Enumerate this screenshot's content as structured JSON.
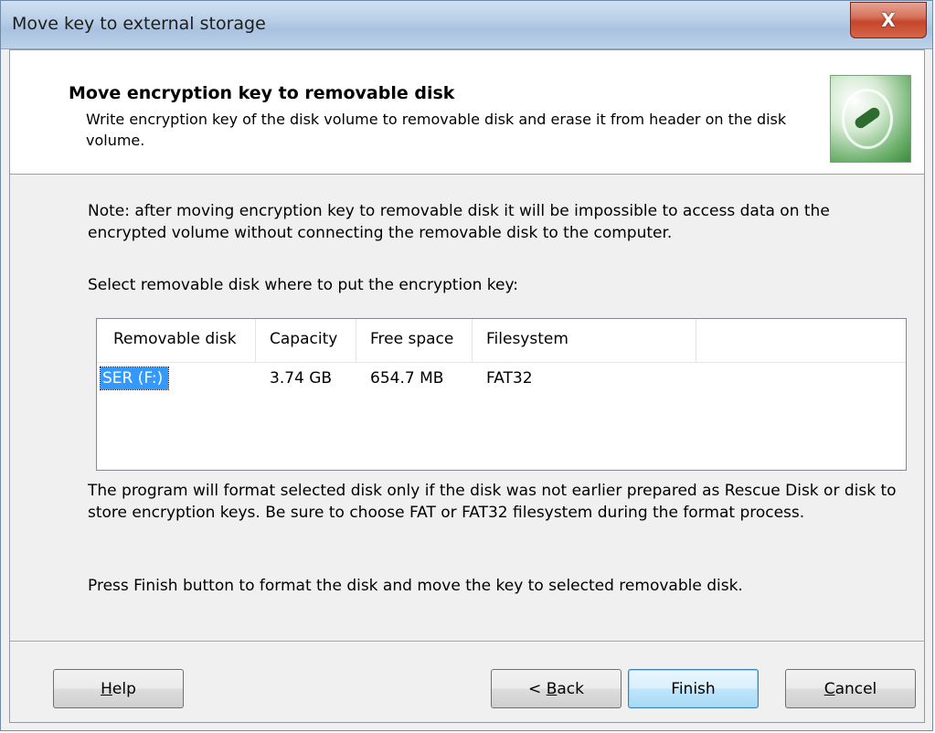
{
  "window": {
    "title": "Move key to external storage",
    "close_label": "X"
  },
  "header": {
    "title": "Move encryption key to removable disk",
    "subtitle": "Write encryption key of the disk volume to removable disk and erase it from header on the disk volume.",
    "logo_icon": "key-lock-icon"
  },
  "body": {
    "note": "Note: after moving encryption key to removable disk it will be impossible to access data on the encrypted volume without connecting the removable disk to the computer.",
    "select_prompt": "Select removable disk where to put the encryption key:",
    "format_info": "The program will format selected disk only if the disk was not earlier prepared as Rescue Disk or disk to store encryption keys. Be sure to choose FAT or FAT32 filesystem during the format process.",
    "finish_hint": "Press Finish button to format the disk and move the key to selected removable disk."
  },
  "disk_list": {
    "columns": [
      "Removable disk",
      "Capacity",
      "Free space",
      "Filesystem",
      ""
    ],
    "rows": [
      {
        "disk": "SER (F:)",
        "capacity": "3.74 GB",
        "free_space": "654.7 MB",
        "filesystem": "FAT32",
        "selected": true
      }
    ]
  },
  "buttons": {
    "help": {
      "pre": "",
      "accel": "H",
      "post": "elp"
    },
    "back": {
      "pre": "< ",
      "accel": "B",
      "post": "ack"
    },
    "finish": {
      "label": "Finish"
    },
    "cancel": {
      "pre": "",
      "accel": "C",
      "post": "ancel"
    }
  },
  "colors": {
    "selection": "#3399ff",
    "default_button_border": "#3c7fb1",
    "close_button": "#c6462b"
  }
}
